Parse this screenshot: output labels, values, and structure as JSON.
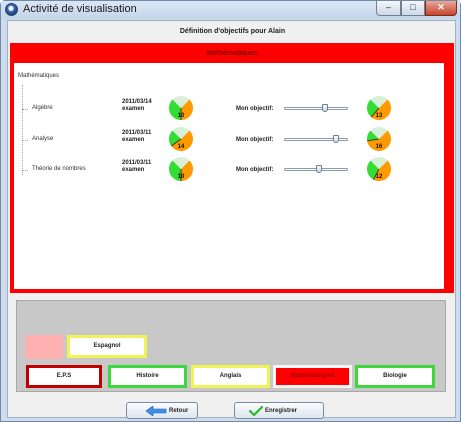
{
  "window": {
    "title": "Activité de visualisation",
    "controls": {
      "minimize": "–",
      "maximize": "□",
      "close": "✕"
    }
  },
  "heading": "Définition d'objectifs pour Alain",
  "subject_panel": {
    "title": "Mathématiques",
    "root_label": "Mathématiques",
    "objective_label": "Mon objectif:",
    "rows": [
      {
        "name": "Algèbre",
        "date": "2011/03/14",
        "exam": "examen",
        "score": "10",
        "score_fraction": 0.5,
        "objective": "13",
        "objective_fraction": 0.65,
        "slider_fraction": 0.65
      },
      {
        "name": "Analyse",
        "date": "2011/03/11",
        "exam": "examen",
        "score": "14",
        "score_fraction": 0.7,
        "objective": "16",
        "objective_fraction": 0.8,
        "slider_fraction": 0.85
      },
      {
        "name": "Théorie de nombres",
        "date": "2011/03/11",
        "exam": "examen",
        "score": "10",
        "score_fraction": 0.5,
        "objective": "12",
        "objective_fraction": 0.6,
        "slider_fraction": 0.55
      }
    ],
    "gauge_colors": {
      "low": "#ff9900",
      "high": "#33dd33",
      "empty": "#d8f0d8"
    }
  },
  "subject_tabs": {
    "top": [
      {
        "label": "Espagnol",
        "color": "yellow"
      }
    ],
    "bottom": [
      {
        "label": "E.P.S",
        "color": "red"
      },
      {
        "label": "Histoire",
        "color": "green"
      },
      {
        "label": "Anglais",
        "color": "yellow"
      },
      {
        "label": "Mathématiques",
        "color": "active"
      },
      {
        "label": "Biologie",
        "color": "green"
      }
    ]
  },
  "buttons": {
    "back": {
      "label": "Retour",
      "icon": "back-arrow-icon"
    },
    "save": {
      "label": "Enregistrer",
      "icon": "checkmark-icon"
    }
  },
  "colors": {
    "accent_red": "#ff0000",
    "title_bar": "#c4d5ea"
  }
}
